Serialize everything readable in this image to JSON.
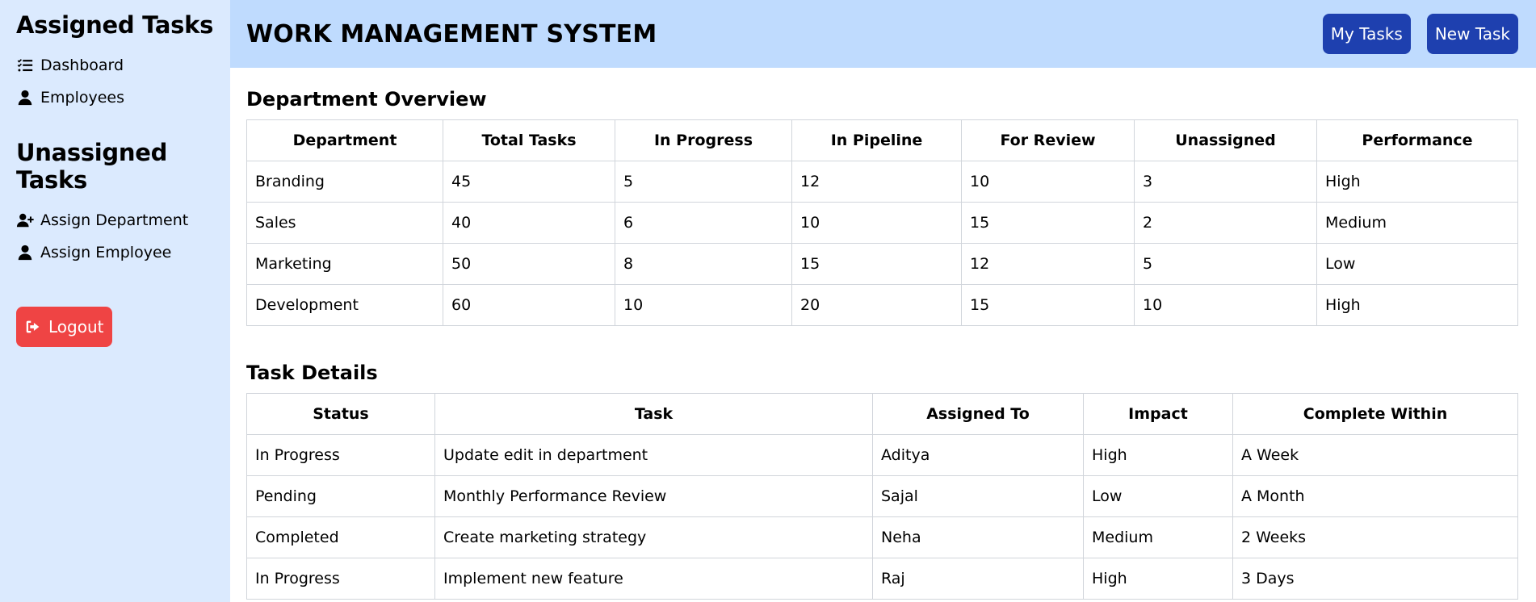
{
  "sidebar": {
    "assigned_heading": "Assigned Tasks",
    "assigned_items": [
      {
        "label": "Dashboard",
        "icon": "list-check-icon"
      },
      {
        "label": "Employees",
        "icon": "user-icon"
      }
    ],
    "unassigned_heading": "Unassigned Tasks",
    "unassigned_items": [
      {
        "label": "Assign Department",
        "icon": "user-plus-icon"
      },
      {
        "label": "Assign Employee",
        "icon": "user-icon"
      }
    ],
    "logout_label": "Logout"
  },
  "header": {
    "title": "WORK MANAGEMENT SYSTEM",
    "my_tasks_label": "My Tasks",
    "new_task_label": "New Task"
  },
  "department_overview": {
    "heading": "Department Overview",
    "columns": [
      "Department",
      "Total Tasks",
      "In Progress",
      "In Pipeline",
      "For Review",
      "Unassigned",
      "Performance"
    ],
    "rows": [
      [
        "Branding",
        "45",
        "5",
        "12",
        "10",
        "3",
        "High"
      ],
      [
        "Sales",
        "40",
        "6",
        "10",
        "15",
        "2",
        "Medium"
      ],
      [
        "Marketing",
        "50",
        "8",
        "15",
        "12",
        "5",
        "Low"
      ],
      [
        "Development",
        "60",
        "10",
        "20",
        "15",
        "10",
        "High"
      ]
    ]
  },
  "task_details": {
    "heading": "Task Details",
    "columns": [
      "Status",
      "Task",
      "Assigned To",
      "Impact",
      "Complete Within"
    ],
    "rows": [
      [
        "In Progress",
        "Update edit in department",
        "Aditya",
        "High",
        "A Week"
      ],
      [
        "Pending",
        "Monthly Performance Review",
        "Sajal",
        "Low",
        "A Month"
      ],
      [
        "Completed",
        "Create marketing strategy",
        "Neha",
        "Medium",
        "2 Weeks"
      ],
      [
        "In Progress",
        "Implement new feature",
        "Raj",
        "High",
        "3 Days"
      ]
    ]
  },
  "colors": {
    "sidebar_bg": "#dbeafe",
    "header_bg": "#bfdbfe",
    "primary_button": "#1e40af",
    "logout_button": "#ef4444"
  }
}
